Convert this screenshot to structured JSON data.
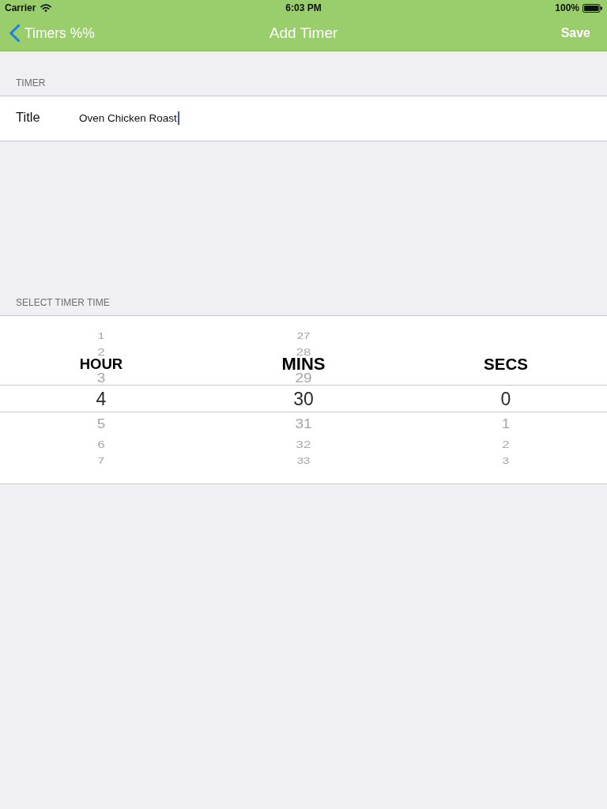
{
  "status_bar": {
    "carrier": "Carrier",
    "time": "6:03 PM",
    "battery": "100%"
  },
  "nav_bar": {
    "back_label": "Timers %%",
    "title": "Add Timer",
    "action": "Save"
  },
  "sections": [
    {
      "kind": "form",
      "header": "TIMER",
      "rows": [
        {
          "label": "Title",
          "value": "Oven Chicken Roast",
          "focused": true
        }
      ]
    },
    {
      "kind": "picker",
      "header": "SELECT TIMER TIME",
      "columns": [
        {
          "label": "HOUR",
          "rows": [
            {
              "text": "1",
              "selected": false
            },
            {
              "text": "2",
              "selected": false
            },
            {
              "text": "3",
              "selected": false
            },
            {
              "text": "4",
              "selected": true
            },
            {
              "text": "5",
              "selected": false
            },
            {
              "text": "6",
              "selected": false
            },
            {
              "text": "7",
              "selected": false
            }
          ]
        },
        {
          "label": "MINS",
          "rows": [
            {
              "text": "27",
              "selected": false
            },
            {
              "text": "28",
              "selected": false
            },
            {
              "text": "29",
              "selected": false
            },
            {
              "text": "30",
              "selected": true
            },
            {
              "text": "31",
              "selected": false
            },
            {
              "text": "32",
              "selected": false
            },
            {
              "text": "33",
              "selected": false
            }
          ]
        },
        {
          "label": "SECS",
          "rows": [
            {
              "text": "0",
              "selected": true
            },
            {
              "text": "1",
              "selected": false
            },
            {
              "text": "2",
              "selected": false
            },
            {
              "text": "3",
              "selected": false
            }
          ]
        }
      ]
    }
  ]
}
